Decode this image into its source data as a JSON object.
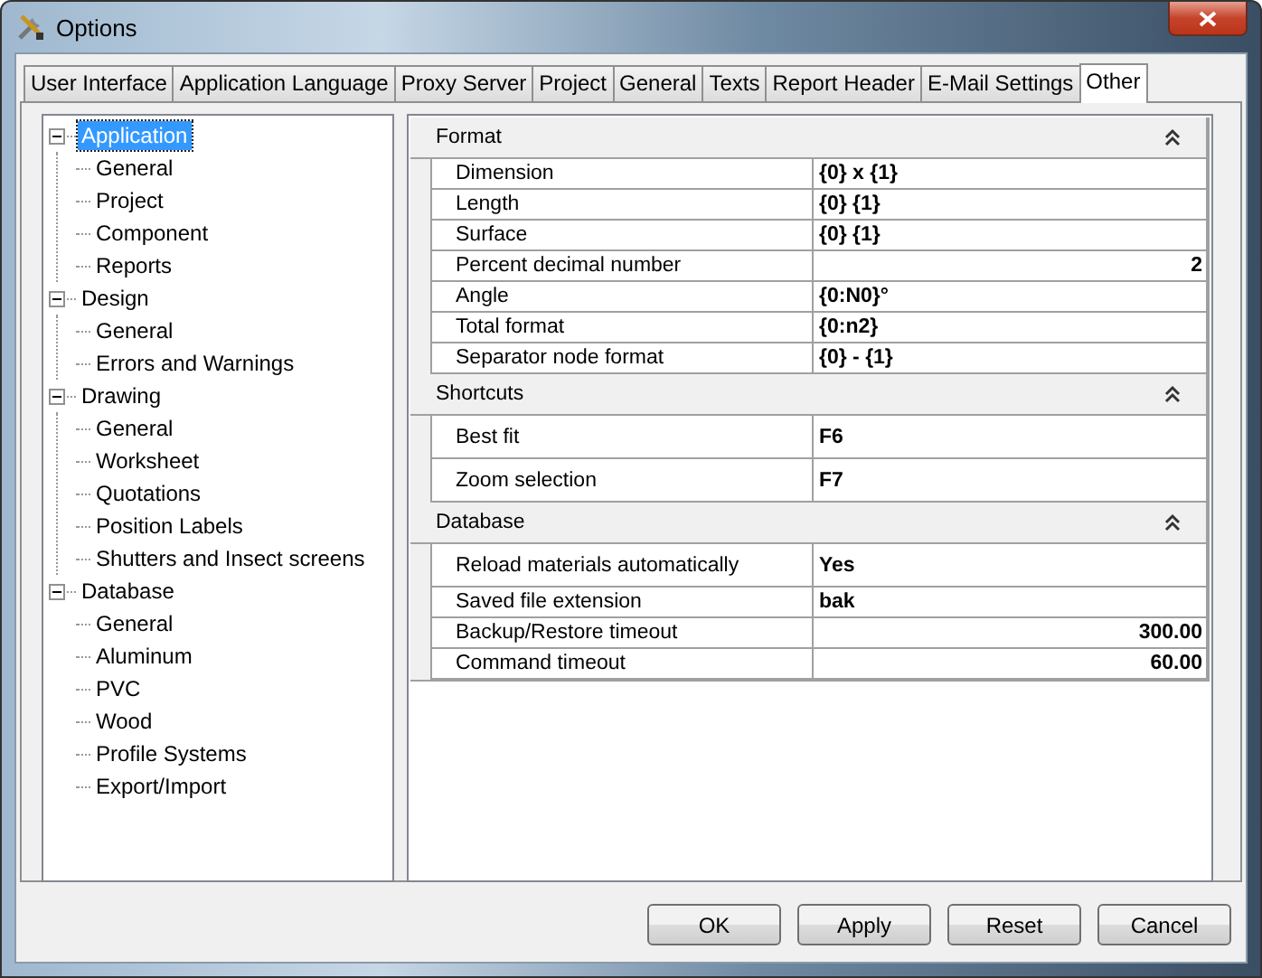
{
  "window": {
    "title": "Options"
  },
  "tabs": [
    {
      "label": "User Interface",
      "selected": false
    },
    {
      "label": "Application Language",
      "selected": false
    },
    {
      "label": "Proxy Server",
      "selected": false
    },
    {
      "label": "Project",
      "selected": false
    },
    {
      "label": "General",
      "selected": false
    },
    {
      "label": "Texts",
      "selected": false
    },
    {
      "label": "Report Header",
      "selected": false
    },
    {
      "label": "E-Mail Settings",
      "selected": false
    },
    {
      "label": "Other",
      "selected": true
    }
  ],
  "tree": [
    {
      "label": "Application",
      "expanded": true,
      "selected": true,
      "children": [
        {
          "label": "General",
          "selected": false
        },
        {
          "label": "Project",
          "selected": false
        },
        {
          "label": "Component",
          "selected": false
        },
        {
          "label": "Reports",
          "selected": false
        }
      ]
    },
    {
      "label": "Design",
      "expanded": true,
      "selected": false,
      "children": [
        {
          "label": "General",
          "selected": false
        },
        {
          "label": "Errors and Warnings",
          "selected": false
        }
      ]
    },
    {
      "label": "Drawing",
      "expanded": true,
      "selected": false,
      "children": [
        {
          "label": "General",
          "selected": false
        },
        {
          "label": "Worksheet",
          "selected": false
        },
        {
          "label": "Quotations",
          "selected": false
        },
        {
          "label": "Position Labels",
          "selected": false
        },
        {
          "label": "Shutters and Insect screens",
          "selected": false
        }
      ]
    },
    {
      "label": "Database",
      "expanded": true,
      "selected": false,
      "children": [
        {
          "label": "General",
          "selected": false
        },
        {
          "label": "Aluminum",
          "selected": false
        },
        {
          "label": "PVC",
          "selected": false
        },
        {
          "label": "Wood",
          "selected": false
        },
        {
          "label": "Profile Systems",
          "selected": false
        },
        {
          "label": "Export/Import",
          "selected": false
        }
      ]
    }
  ],
  "sections": [
    {
      "title": "Format",
      "expanded": true,
      "rows": [
        {
          "name": "Dimension",
          "value": "{0} x {1}",
          "kind": "text"
        },
        {
          "name": "Length",
          "value": "{0} {1}",
          "kind": "text"
        },
        {
          "name": "Surface",
          "value": "{0} {1}",
          "kind": "text"
        },
        {
          "name": "Percent decimal number",
          "value": "2",
          "kind": "number"
        },
        {
          "name": "Angle",
          "value": "{0:N0}°",
          "kind": "text"
        },
        {
          "name": "Total format",
          "value": "{0:n2}",
          "kind": "text"
        },
        {
          "name": "Separator node format",
          "value": "{0} - {1}",
          "kind": "text"
        }
      ]
    },
    {
      "title": "Shortcuts",
      "expanded": true,
      "rows": [
        {
          "name": "Best fit",
          "value": "F6",
          "kind": "tall"
        },
        {
          "name": "Zoom selection",
          "value": "F7",
          "kind": "tall"
        }
      ]
    },
    {
      "title": "Database",
      "expanded": true,
      "rows": [
        {
          "name": "Reload materials automatically",
          "value": "Yes",
          "kind": "tall"
        },
        {
          "name": "Saved file extension",
          "value": "bak",
          "kind": "text"
        },
        {
          "name": "Backup/Restore timeout",
          "value": "300.00",
          "kind": "number"
        },
        {
          "name": "Command timeout",
          "value": "60.00",
          "kind": "number"
        }
      ]
    }
  ],
  "buttons": [
    "OK",
    "Apply",
    "Reset",
    "Cancel"
  ]
}
